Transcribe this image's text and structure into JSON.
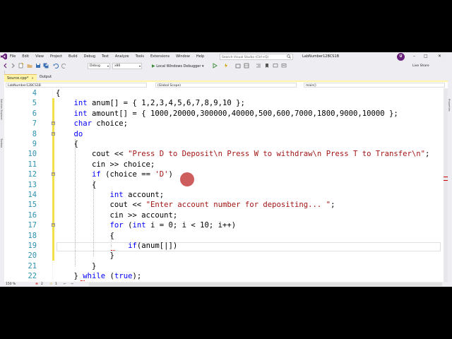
{
  "menu": {
    "items": [
      "File",
      "Edit",
      "View",
      "Project",
      "Build",
      "Debug",
      "Test",
      "Analyze",
      "Tools",
      "Extensions",
      "Window",
      "Help"
    ],
    "search_placeholder": "Search Visual Studio (Ctrl+Q)",
    "solution_name": "LabNumber12BCS1B",
    "user_initial": "U"
  },
  "toolbar": {
    "config": "Debug",
    "platform": "x86",
    "debugger": "Local Windows Debugger",
    "live_share": "Live Share"
  },
  "tabs": [
    {
      "label": "Source.cpp*",
      "active": true
    },
    {
      "label": "Output",
      "active": false
    }
  ],
  "navbar": {
    "project": "LabNumber12BCS1B",
    "scope": "(Global Scope)",
    "member": "main()"
  },
  "left_strip": [
    "Solution Explorer",
    "Toolbox"
  ],
  "right_strip": [
    "Properties"
  ],
  "code": [
    {
      "n": "4",
      "tokens": [
        [
          "p",
          "{"
        ]
      ]
    },
    {
      "n": "5",
      "tokens": [
        [
          "p",
          "    "
        ],
        [
          "k",
          "int"
        ],
        [
          "p",
          " anum[] = { 1,2,3,4,5,6,7,8,9,10 };"
        ]
      ]
    },
    {
      "n": "6",
      "tokens": [
        [
          "p",
          "    "
        ],
        [
          "k",
          "int"
        ],
        [
          "p",
          " amount[] = { 1000,20000,300000,40000,500,600,7000,1800,9000,10000 };"
        ]
      ]
    },
    {
      "n": "7",
      "tokens": [
        [
          "p",
          "    "
        ],
        [
          "k",
          "char"
        ],
        [
          "p",
          " choice;"
        ]
      ]
    },
    {
      "n": "8",
      "tokens": [
        [
          "p",
          "    "
        ],
        [
          "k",
          "do"
        ]
      ]
    },
    {
      "n": "9",
      "tokens": [
        [
          "p",
          "    {"
        ]
      ]
    },
    {
      "n": "10",
      "tokens": [
        [
          "p",
          "        cout << "
        ],
        [
          "s",
          "\"Press D to Deposit\\n Press W to withdraw\\n Press T to Transfer\\n\""
        ],
        [
          "p",
          ";"
        ]
      ]
    },
    {
      "n": "11",
      "tokens": [
        [
          "p",
          "        cin >> choice;"
        ]
      ]
    },
    {
      "n": "12",
      "tokens": [
        [
          "p",
          "        "
        ],
        [
          "k",
          "if"
        ],
        [
          "p",
          " (choice == "
        ],
        [
          "s",
          "'D'"
        ],
        [
          "p",
          ")"
        ]
      ]
    },
    {
      "n": "13",
      "tokens": [
        [
          "p",
          "        {"
        ]
      ]
    },
    {
      "n": "14",
      "tokens": [
        [
          "p",
          "            "
        ],
        [
          "k",
          "int"
        ],
        [
          "p",
          " account;"
        ]
      ]
    },
    {
      "n": "15",
      "tokens": [
        [
          "p",
          "            cout << "
        ],
        [
          "s",
          "\"Enter account number for depositing... \""
        ],
        [
          "p",
          ";"
        ]
      ]
    },
    {
      "n": "16",
      "tokens": [
        [
          "p",
          "            cin >> account;"
        ]
      ]
    },
    {
      "n": "17",
      "tokens": [
        [
          "p",
          "            "
        ],
        [
          "k",
          "for"
        ],
        [
          "p",
          " ("
        ],
        [
          "k",
          "int"
        ],
        [
          "p",
          " i = 0; i < 10; i++)"
        ]
      ]
    },
    {
      "n": "18",
      "tokens": [
        [
          "p",
          "            {"
        ]
      ]
    },
    {
      "n": "19",
      "tokens": [
        [
          "p",
          "                "
        ],
        [
          "k",
          "if"
        ],
        [
          "p",
          "(anum[|])"
        ]
      ]
    },
    {
      "n": "20",
      "tokens": [
        [
          "p",
          "            }"
        ]
      ]
    },
    {
      "n": "21",
      "tokens": [
        [
          "p",
          "        }"
        ]
      ]
    },
    {
      "n": "22",
      "tokens": [
        [
          "p",
          "    } "
        ],
        [
          "k",
          "while"
        ],
        [
          "p",
          " ("
        ],
        [
          "k",
          "true"
        ],
        [
          "p",
          ");"
        ]
      ]
    }
  ],
  "status": {
    "zoom": "150 %",
    "errors": "2",
    "warnings": "1"
  },
  "colors": {
    "keyword": "#0000ff",
    "string": "#a31515",
    "line_number": "#2b91af",
    "active_tab": "#fff4a8",
    "cursor_dot": "#be2828"
  }
}
